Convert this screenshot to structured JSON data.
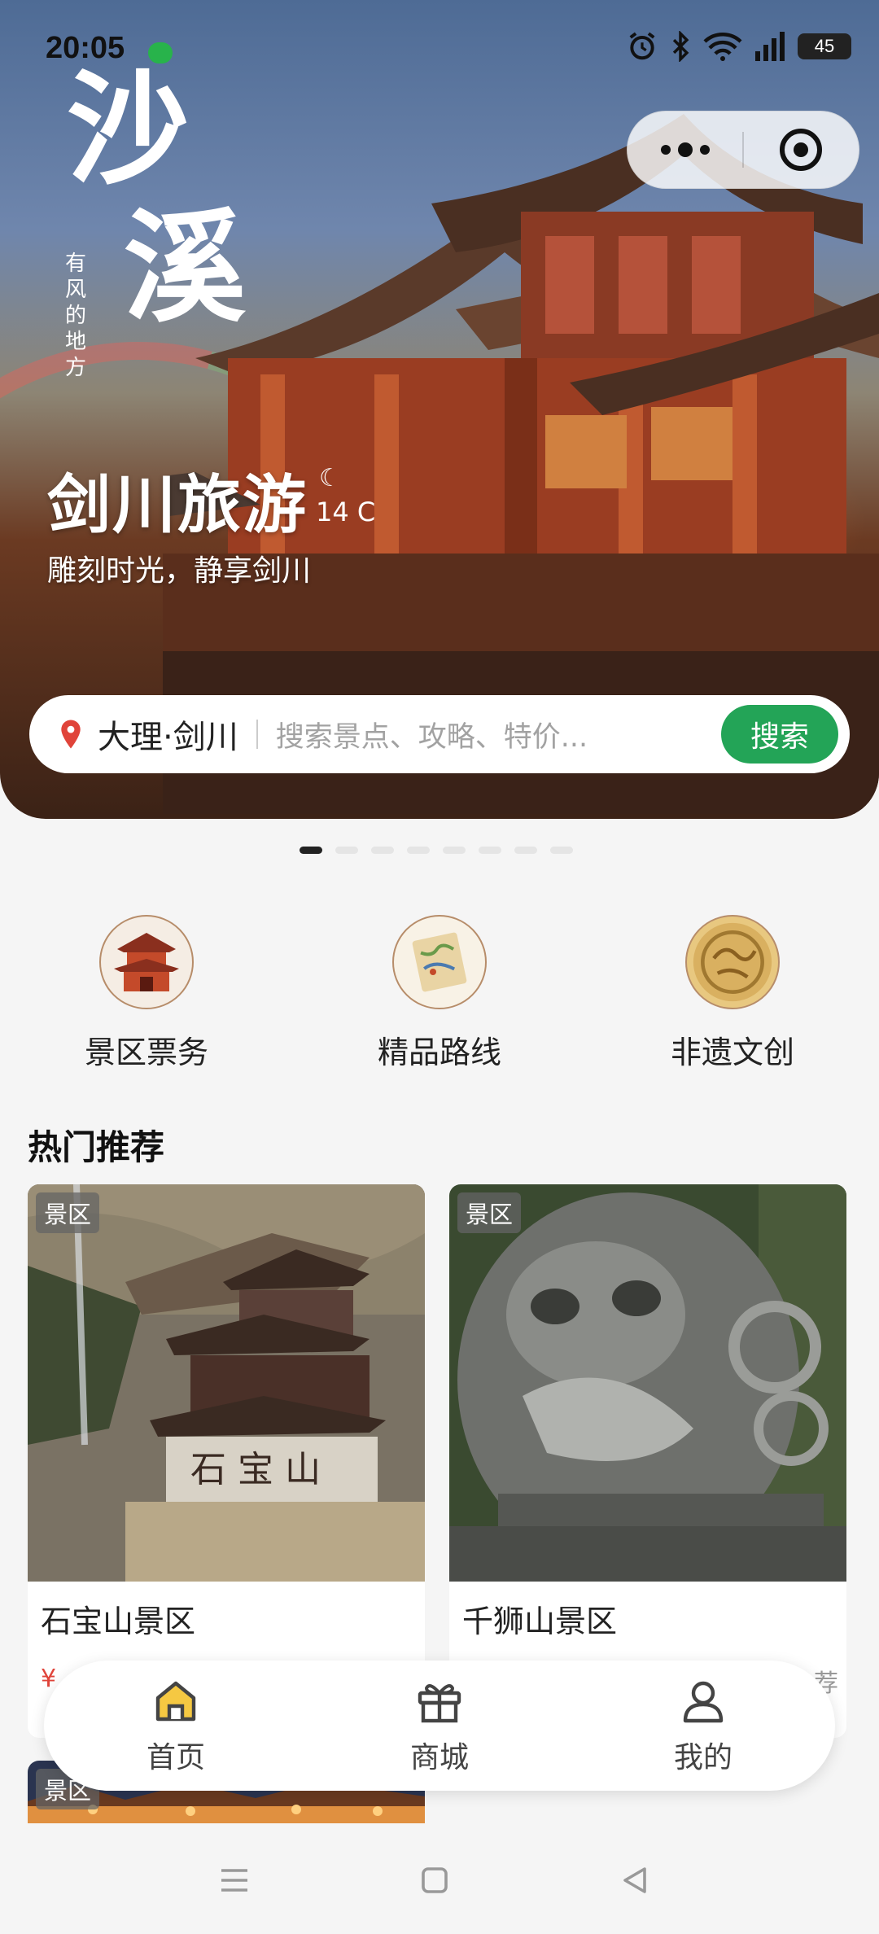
{
  "status_bar": {
    "time": "20:05",
    "battery": "45"
  },
  "hero": {
    "calligraphy_main": "沙溪",
    "calligraphy_small": "有风的地方",
    "title": "剑川旅游",
    "weather_icon": "moon-icon",
    "temperature": "14 C",
    "subtitle": "雕刻时光，静享剑川"
  },
  "search": {
    "location": "大理·剑川",
    "placeholder": "搜索景点、攻略、特价...",
    "button": "搜索"
  },
  "banner_pages": {
    "count": 8,
    "active_index": 0
  },
  "quick_entries": [
    {
      "label": "景区票务",
      "icon": "pagoda-icon"
    },
    {
      "label": "精品路线",
      "icon": "scroll-map-icon"
    },
    {
      "label": "非遗文创",
      "icon": "carved-plate-icon"
    }
  ],
  "section_title": "热门推荐",
  "cards": [
    {
      "tag": "景区",
      "name": "石宝山景区",
      "price": "¥"
    },
    {
      "tag": "景区",
      "name": "千狮山景区",
      "more": "荐"
    },
    {
      "tag": "景区"
    }
  ],
  "tabbar": [
    {
      "label": "首页",
      "icon": "home-icon",
      "active": true
    },
    {
      "label": "商城",
      "icon": "gift-icon",
      "active": false
    },
    {
      "label": "我的",
      "icon": "user-icon",
      "active": false
    }
  ],
  "colors": {
    "accent": "#23a457",
    "price": "#e0443a",
    "home_active": "#f5c842"
  }
}
